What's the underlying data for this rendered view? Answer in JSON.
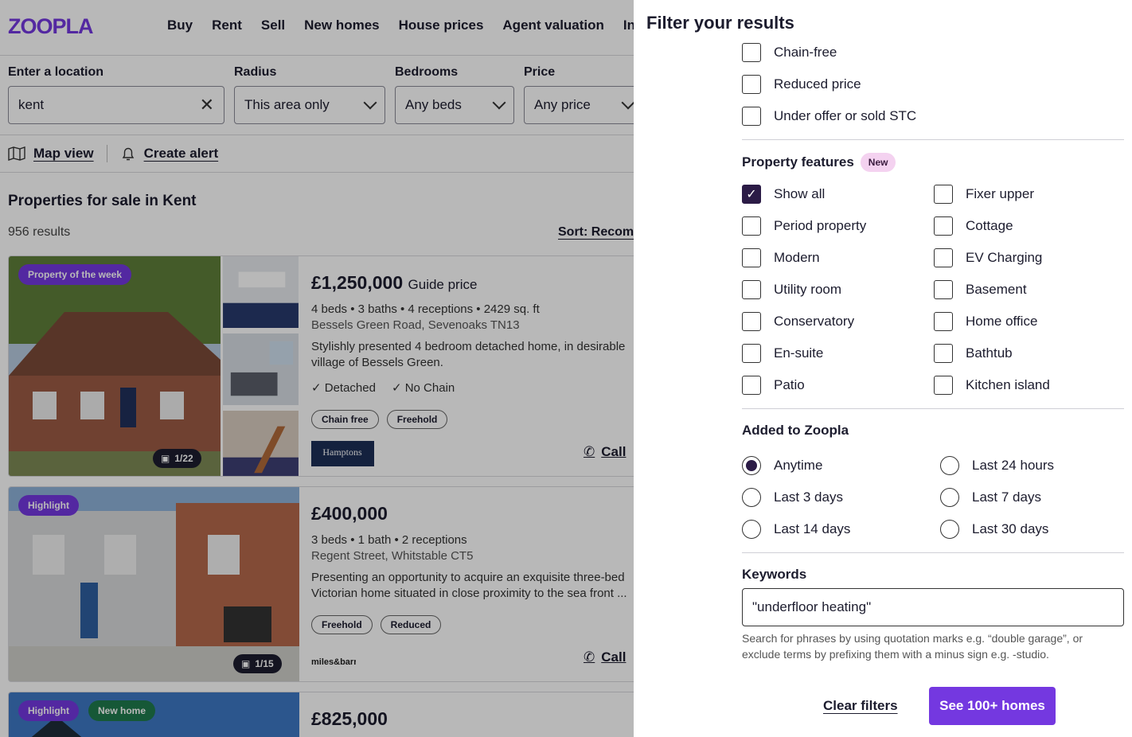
{
  "header": {
    "logo": "ZOOPLA",
    "nav": [
      "Buy",
      "Rent",
      "Sell",
      "New homes",
      "House prices",
      "Agent valuation",
      "Inst"
    ]
  },
  "search": {
    "location_label": "Enter a location",
    "location_value": "kent",
    "radius_label": "Radius",
    "radius_value": "This area only",
    "bedrooms_label": "Bedrooms",
    "bedrooms_value": "Any beds",
    "price_label": "Price",
    "price_value": "Any price"
  },
  "toolbar": {
    "map_view": "Map view",
    "create_alert": "Create alert"
  },
  "results": {
    "title": "Properties for sale in Kent",
    "count": "956 results",
    "sort": "Sort: Recom"
  },
  "listings": [
    {
      "badge": "Property of the week",
      "photo_count": "1/22",
      "price": "£1,250,000",
      "price_qualifier": "Guide price",
      "specs": "4 beds • 3 baths • 4 receptions • 2429 sq. ft",
      "address": "Bessels Green Road, Sevenoaks TN13",
      "description": "Stylishly presented 4 bedroom detached home, in desirable village of Bessels Green.",
      "features": [
        "Detached",
        "No Chain"
      ],
      "chips": [
        "Chain free",
        "Freehold"
      ],
      "agent": "Hamptons",
      "call": "Call"
    },
    {
      "badge": "Highlight",
      "photo_count": "1/15",
      "price": "£400,000",
      "specs": "3 beds • 1 bath • 2 receptions",
      "address": "Regent Street, Whitstable CT5",
      "description": "Presenting an opportunity to acquire an exquisite three-bed Victorian home situated in close proximity to the sea front ...",
      "chips": [
        "Freehold",
        "Reduced"
      ],
      "agent": "miles&barr",
      "call": "Call"
    },
    {
      "badge": "Highlight",
      "badge2": "New home",
      "price": "£825,000"
    }
  ],
  "panel": {
    "title": "Filter your results",
    "status_options": [
      "Chain-free",
      "Reduced price",
      "Under offer or sold STC"
    ],
    "features_title": "Property features",
    "features_new_badge": "New",
    "features_left": [
      "Show all",
      "Period property",
      "Modern",
      "Utility room",
      "Conservatory",
      "En-suite",
      "Patio"
    ],
    "features_right": [
      "Fixer upper",
      "Cottage",
      "EV Charging",
      "Basement",
      "Home office",
      "Bathtub",
      "Kitchen island"
    ],
    "added_title": "Added to Zoopla",
    "added_left": [
      "Anytime",
      "Last 3 days",
      "Last 14 days"
    ],
    "added_right": [
      "Last 24 hours",
      "Last 7 days",
      "Last 30 days"
    ],
    "keywords_title": "Keywords",
    "keywords_value": "\"underfloor heating\"",
    "keywords_hint": "Search for phrases by using quotation marks e.g. “double garage”, or exclude terms by prefixing them with a minus sign e.g. -studio.",
    "clear_label": "Clear filters",
    "submit_label": "See 100+ homes"
  },
  "colors": {
    "brand": "#7438e0",
    "checked": "#2b1b46",
    "new_pill": "#f4d2f0"
  }
}
